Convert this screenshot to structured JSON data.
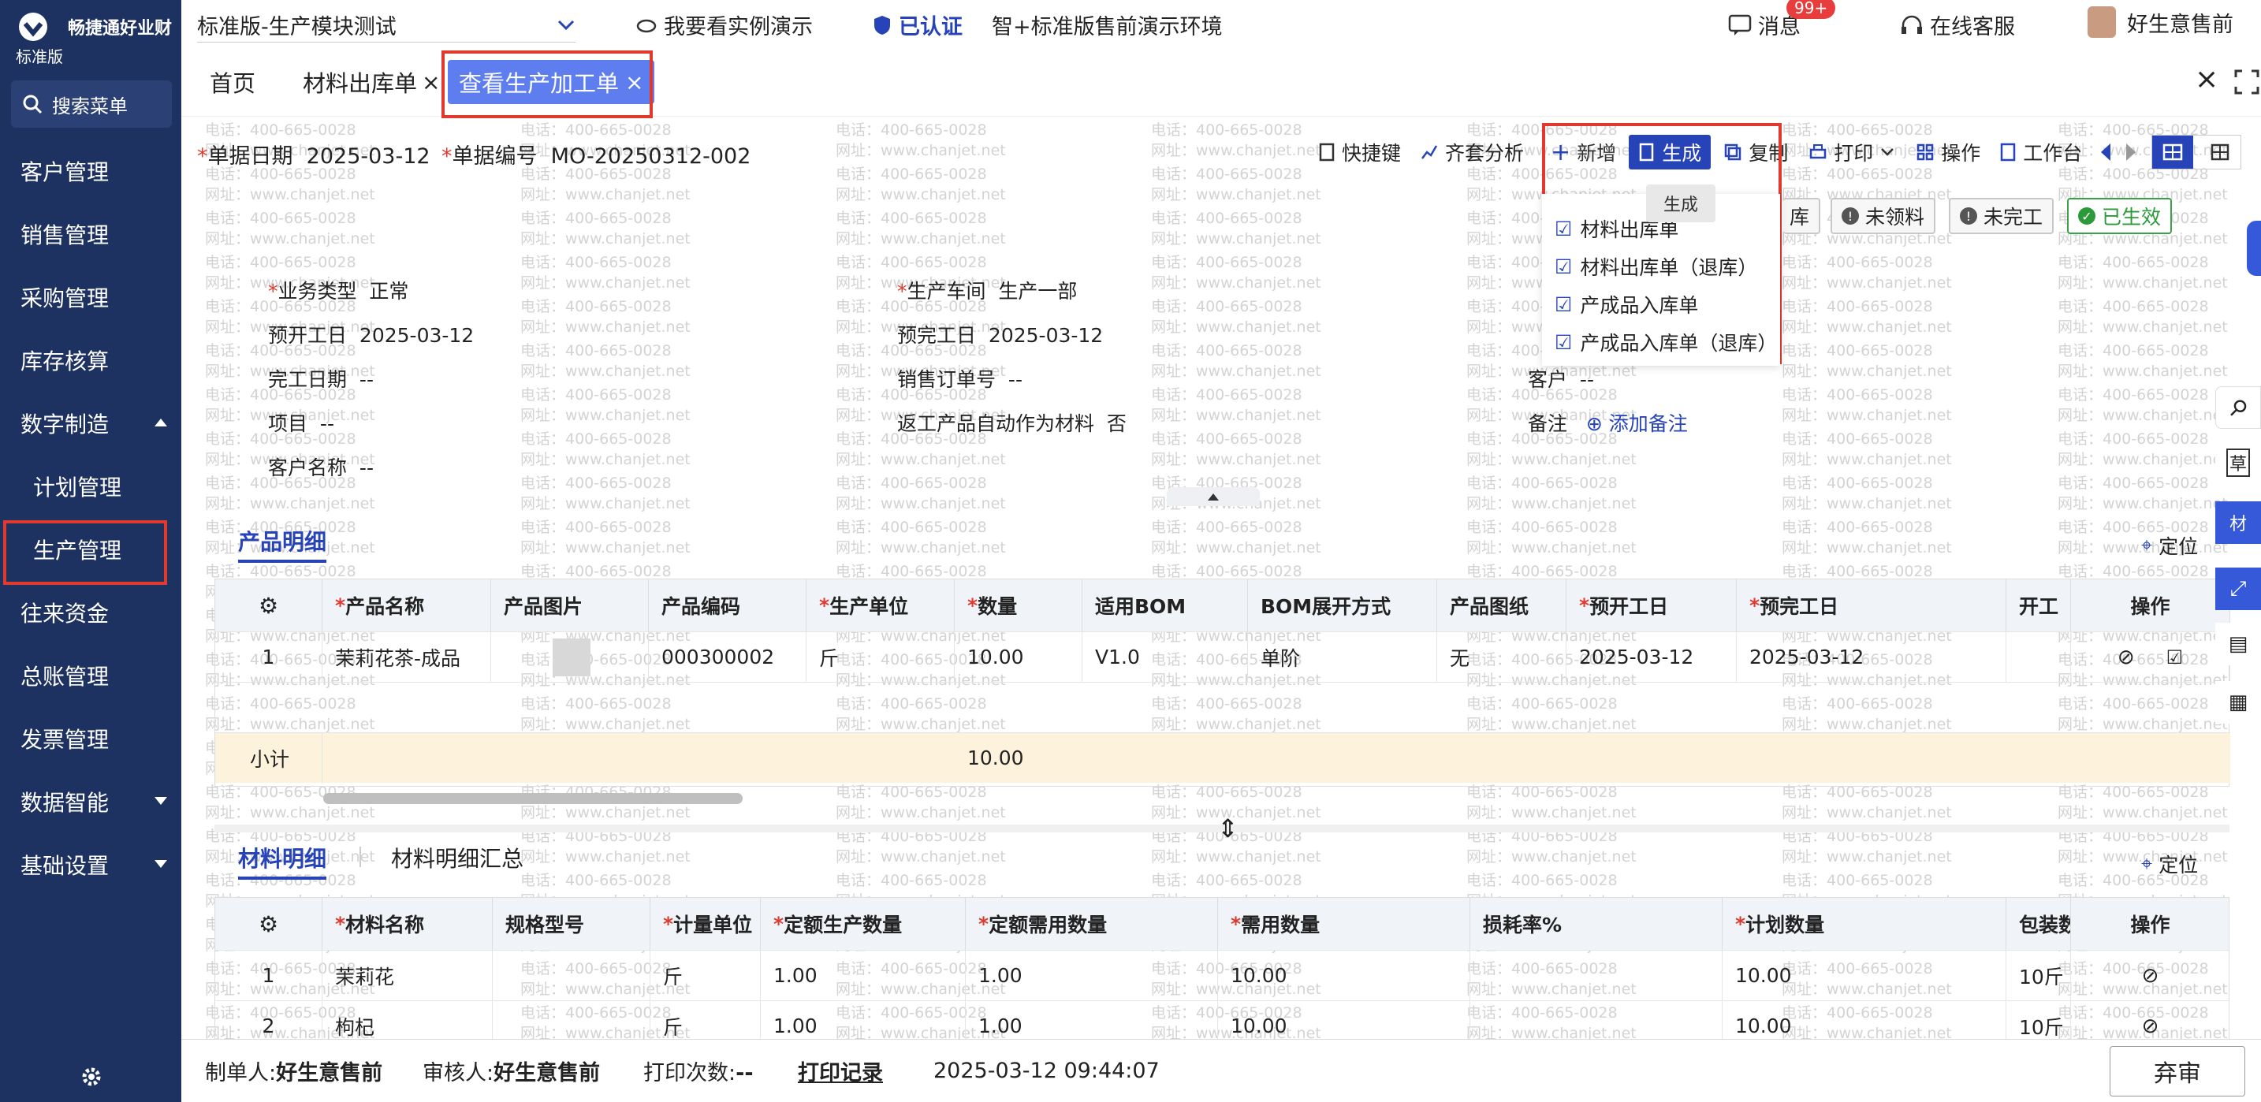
{
  "app": {
    "brand": "畅捷通好业财",
    "edition": "标准版",
    "search_label": "搜索菜单"
  },
  "sidebar": {
    "items": [
      {
        "label": "客户管理"
      },
      {
        "label": "销售管理"
      },
      {
        "label": "采购管理"
      },
      {
        "label": "库存核算"
      },
      {
        "label": "数字制造"
      },
      {
        "label": "计划管理"
      },
      {
        "label": "生产管理"
      },
      {
        "label": "往来资金"
      },
      {
        "label": "总账管理"
      },
      {
        "label": "发票管理"
      },
      {
        "label": "数据智能"
      },
      {
        "label": "基础设置"
      }
    ]
  },
  "topbar": {
    "account": "标准版-生产模块测试",
    "demo": "我要看实例演示",
    "certified": "已认证",
    "env": "智+标准版售前演示环境",
    "messages": "消息",
    "messages_badge": "99+",
    "support": "在线客服",
    "user": "好生意售前"
  },
  "tabs": [
    {
      "label": "首页"
    },
    {
      "label": "材料出库单"
    },
    {
      "label": "查看生产加工单"
    }
  ],
  "header": {
    "date_label": "单据日期",
    "date_value": "2025-03-12",
    "no_label": "单据编号",
    "no_value": "MO-20250312-002"
  },
  "toolbar": {
    "shortcut": "快捷键",
    "kit": "齐套分析",
    "add": "新增",
    "generate": "生成",
    "copy": "复制",
    "print": "打印",
    "ops": "操作",
    "workbench": "工作台"
  },
  "tooltip": "生成",
  "dropdown": [
    "材料出库单",
    "材料出库单（退库）",
    "产成品入库单",
    "产成品入库单（退库）"
  ],
  "statuses": {
    "partial": "库",
    "not_picked": "未领料",
    "not_done": "未完工",
    "effective": "已生效"
  },
  "fields": {
    "biz_type_label": "业务类型",
    "biz_type": "正常",
    "workshop_label": "生产车间",
    "workshop": "生产一部",
    "start_label": "预开工日",
    "start": "2025-03-12",
    "end_label": "预完工日",
    "end": "2025-03-12",
    "done_label": "完工日期",
    "done": "--",
    "so_label": "销售订单号",
    "so": "--",
    "customer_label": "客户",
    "customer": "--",
    "project_label": "项目",
    "project": "--",
    "rework_label": "返工产品自动作为材料",
    "rework": "否",
    "note_label": "备注",
    "note_add": "添加备注",
    "custname_label": "客户名称",
    "custname": "--"
  },
  "product": {
    "tab": "产品明细",
    "locate": "定位",
    "headers": [
      "产品名称",
      "产品图片",
      "产品编码",
      "生产单位",
      "数量",
      "适用BOM",
      "BOM展开方式",
      "产品图纸",
      "预开工日",
      "预完工日",
      "开工",
      "操作"
    ],
    "row": {
      "idx": "1",
      "name": "茉莉花茶-成品",
      "code": "000300002",
      "unit": "斤",
      "qty": "10.00",
      "bom": "V1.0",
      "expand": "单阶",
      "drawing": "无",
      "start": "2025-03-12",
      "end": "2025-03-12"
    },
    "subtotal_label": "小计",
    "subtotal_qty": "10.00"
  },
  "material": {
    "tab": "材料明细",
    "tab2": "材料明细汇总",
    "locate": "定位",
    "headers": [
      "材料名称",
      "规格型号",
      "计量单位",
      "定额生产数量",
      "定额需用数量",
      "需用数量",
      "损耗率%",
      "计划数量",
      "包装数",
      "操作"
    ],
    "rows": [
      {
        "idx": "1",
        "name": "茉莉花",
        "unit": "斤",
        "q1": "1.00",
        "q2": "1.00",
        "need": "10.00",
        "plan": "10.00",
        "pack": "10斤"
      },
      {
        "idx": "2",
        "name": "枸杞",
        "unit": "斤",
        "q1": "1.00",
        "q2": "1.00",
        "need": "10.00",
        "plan": "10.00",
        "pack": "10斤"
      }
    ]
  },
  "footer": {
    "maker_label": "制单人:",
    "maker": "好生意售前",
    "auditor_label": "审核人:",
    "auditor": "好生意售前",
    "print_label": "打印次数:",
    "print_count": "--",
    "print_log": "打印记录",
    "time": "2025-03-12 09:44:07",
    "abandon": "弃审"
  },
  "watermark": {
    "phone": "电话：400-665-0028",
    "site": "网址：www.chanjet.net"
  }
}
